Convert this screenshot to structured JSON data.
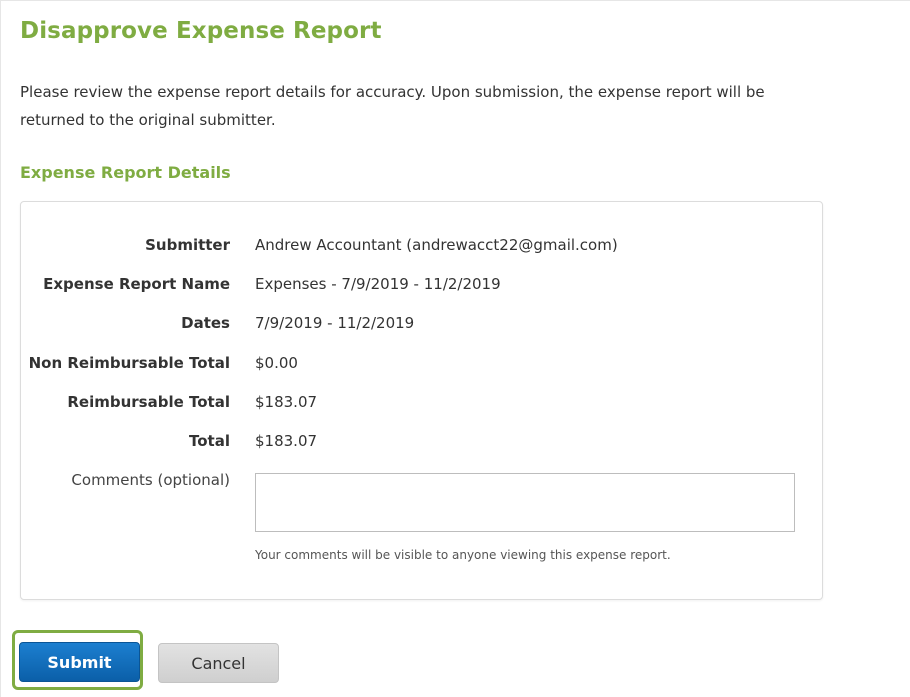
{
  "page": {
    "title": "Disapprove Expense Report",
    "intro": "Please review the expense report details for accuracy. Upon submission, the expense report will be returned to the original submitter.",
    "section_title": "Expense Report Details"
  },
  "details": {
    "submitter_label": "Submitter",
    "submitter_value": "Andrew Accountant (andrewacct22@gmail.com)",
    "report_name_label": "Expense Report Name",
    "report_name_value": "Expenses - 7/9/2019 - 11/2/2019",
    "dates_label": "Dates",
    "dates_value": "7/9/2019 - 11/2/2019",
    "non_reimbursable_label": "Non Reimbursable Total",
    "non_reimbursable_value": "$0.00",
    "reimbursable_label": "Reimbursable Total",
    "reimbursable_value": "$183.07",
    "total_label": "Total",
    "total_value": "$183.07",
    "comments_label": "Comments (optional)",
    "comments_value": "",
    "comments_help": "Your comments will be visible to anyone viewing this expense report."
  },
  "actions": {
    "submit_label": "Submit",
    "cancel_label": "Cancel"
  },
  "colors": {
    "accent_green": "#7fac42",
    "primary_blue": "#0b5fa8",
    "cancel_gray": "#d6d6d6"
  }
}
